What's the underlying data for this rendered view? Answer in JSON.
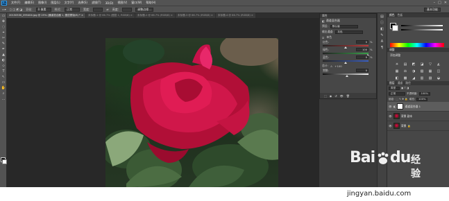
{
  "app": {
    "logo": "Ps"
  },
  "menus": [
    "文件(F)",
    "编辑(E)",
    "图像(I)",
    "图层(L)",
    "文字(Y)",
    "选择(S)",
    "滤镜(T)",
    "3D(D)",
    "视图(V)",
    "窗口(W)",
    "帮助(H)"
  ],
  "window_controls": [
    "–",
    "□",
    "✕"
  ],
  "options_bar": {
    "feather_label": "羽化:",
    "feather_value": "0 像素",
    "style_label": "样式:",
    "style_value": "正常",
    "width_label": "宽度:",
    "height_label": "高度:",
    "refine_button": "调整边缘...",
    "workspace": "基本功能"
  },
  "tabs": [
    {
      "label": "20150530_095404.jpg @ 25% (通道混合器 1, 图层蒙版/8) * ×",
      "active": true
    },
    {
      "label": "未标题-1 @ 66.7% (图层 1, RGB/8) ×",
      "active": false
    },
    {
      "label": "未标题-2 @ 66.7% (RGB/8) ×",
      "active": false
    },
    {
      "label": "未标题-3 @ 66.7% (RGB/8) ×",
      "active": false
    },
    {
      "label": "未标题-4 @ 66.7% (RGB/8) ×",
      "active": false
    }
  ],
  "tools": [
    "▭",
    "✥",
    "◌",
    "⌖",
    "✂",
    "✎",
    "✒",
    "▲",
    "◐",
    "⬦",
    "T",
    "↖",
    "▭",
    "✋",
    "⌕",
    "…"
  ],
  "properties": {
    "panel_tab": "属性",
    "title": "通道混合器",
    "preset_label": "预设:",
    "preset_value": "默认值",
    "output_label": "输出通道:",
    "output_value": "灰色",
    "mono_label": "单色",
    "sliders": [
      {
        "label": "红色:",
        "value": "0",
        "unit": "%",
        "fraction": 0.5,
        "track": "#c23a3a"
      },
      {
        "label": "绿色:",
        "value": "100",
        "unit": "%",
        "fraction": 0.98,
        "track": "#3aa34a"
      },
      {
        "label": "蓝色:",
        "value": "0",
        "unit": "%",
        "fraction": 0.5,
        "track": "#3a5fc2"
      }
    ],
    "total_label": "总计:",
    "total_value": "+100",
    "constant_label": "常数:",
    "constant_value": "0",
    "footer_icons": [
      "⬚",
      "◉",
      "↺",
      "👁",
      "🗑"
    ]
  },
  "right_panel": {
    "color_tabs": [
      "颜色",
      "色板"
    ],
    "adjust_tab": "调整",
    "adjust_heading": "添加调整",
    "adjust_icons": [
      "☀",
      "▤",
      "◩",
      "◪",
      "▽",
      "◭",
      "▦",
      "⚖",
      "◑",
      "▧",
      "▦",
      "◫",
      "◧",
      "▩",
      "◢",
      "▥",
      "▨",
      "◒"
    ],
    "layers_tabs": [
      "图层",
      "通道",
      "路径"
    ],
    "kind_label": "类型",
    "blend_value": "正常",
    "opacity_label": "不透明度:",
    "opacity_value": "100%",
    "lock_label": "锁定:",
    "fill_label": "填充:",
    "fill_value": "100%",
    "layers": [
      {
        "name": "通道混合器 1",
        "thumb": "white",
        "selected": true
      },
      {
        "name": "背景 副本",
        "thumb": "rose",
        "selected": false
      },
      {
        "name": "背景",
        "thumb": "rose",
        "selected": false
      }
    ]
  },
  "watermark": {
    "brand_a": "Bai",
    "brand_b": "du",
    "jingyan": "经验",
    "url": "jingyan.baidu.com"
  }
}
